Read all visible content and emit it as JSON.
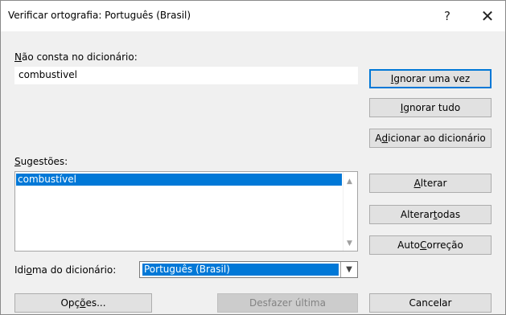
{
  "window": {
    "title": "Verificar ortografia: Português (Brasil)",
    "help_glyph": "?",
    "close_glyph": "✕"
  },
  "not_in_dictionary": {
    "label_u": "N",
    "label_rest": "ão consta no dicionário:",
    "value": "combustivel"
  },
  "suggestions": {
    "label_u": "S",
    "label_rest": "ugestões:",
    "items": [
      "combustível"
    ]
  },
  "dictionary_language": {
    "label_pre": "Idi",
    "label_u": "o",
    "label_post": "ma do dicionário:",
    "value": "Português (Brasil)"
  },
  "buttons": {
    "ignore_once": {
      "u": "I",
      "rest": "gnorar uma vez"
    },
    "ignore_all": {
      "u": "I",
      "rest": "gnorar tudo"
    },
    "add_to_dictionary": {
      "pre": "A",
      "u": "d",
      "rest": "icionar ao dicionário"
    },
    "change": {
      "u": "A",
      "rest": "lterar"
    },
    "change_all": {
      "pre": "Alterar ",
      "u": "t",
      "rest": "odas"
    },
    "autocorrect": {
      "pre": "Auto",
      "u": "C",
      "rest": "orreção"
    },
    "options": {
      "pre": "Opç",
      "u": "õ",
      "rest": "es..."
    },
    "undo_last": {
      "label": "Desfazer última"
    },
    "cancel": {
      "label": "Cancelar"
    }
  },
  "icons": {
    "scroll_up": "▲",
    "scroll_down": "▼",
    "dropdown": "▼"
  }
}
